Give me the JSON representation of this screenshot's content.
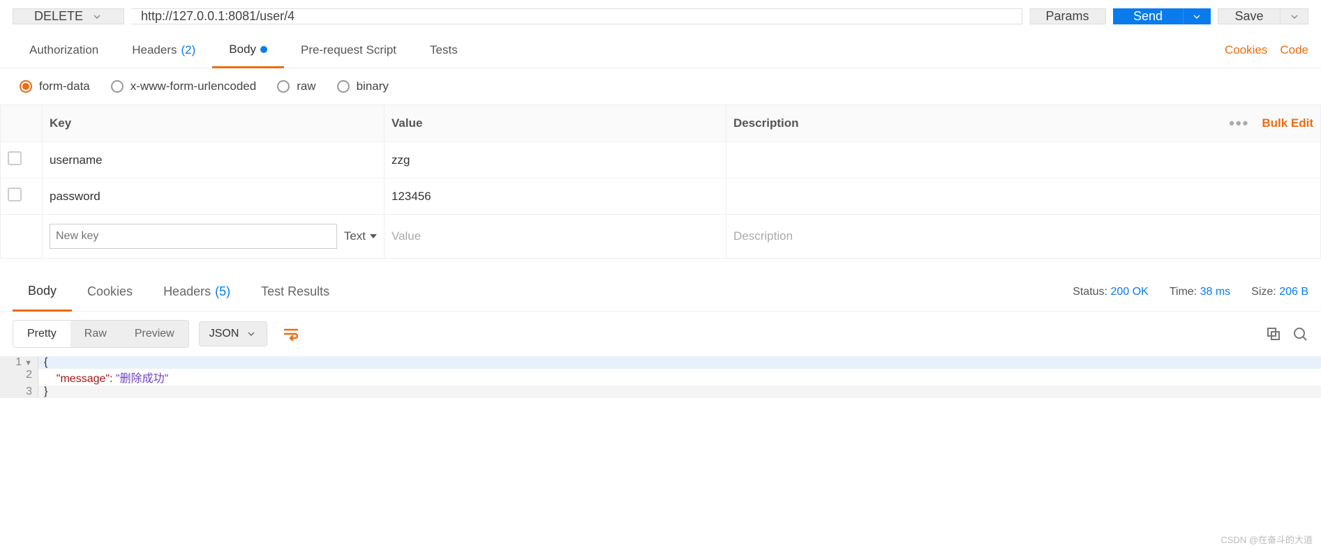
{
  "request": {
    "method": "DELETE",
    "url": "http://127.0.0.1:8081/user/4",
    "params_btn": "Params",
    "send_btn": "Send",
    "save_btn": "Save"
  },
  "req_tabs": {
    "authorization": "Authorization",
    "headers": "Headers",
    "headers_count": "(2)",
    "body": "Body",
    "prerequest": "Pre-request Script",
    "tests": "Tests",
    "cookies_link": "Cookies",
    "code_link": "Code"
  },
  "body_types": {
    "form_data": "form-data",
    "urlencoded": "x-www-form-urlencoded",
    "raw": "raw",
    "binary": "binary"
  },
  "kv_headers": {
    "key": "Key",
    "value": "Value",
    "description": "Description",
    "bulk_edit": "Bulk Edit"
  },
  "kv_rows": [
    {
      "key": "username",
      "value": "zzg"
    },
    {
      "key": "password",
      "value": "123456"
    }
  ],
  "kv_new": {
    "key_placeholder": "New key",
    "type": "Text",
    "value_placeholder": "Value",
    "desc_placeholder": "Description"
  },
  "resp_tabs": {
    "body": "Body",
    "cookies": "Cookies",
    "headers": "Headers",
    "headers_count": "(5)",
    "test_results": "Test Results"
  },
  "resp_meta": {
    "status_label": "Status:",
    "status_value": "200 OK",
    "time_label": "Time:",
    "time_value": "38 ms",
    "size_label": "Size:",
    "size_value": "206 B"
  },
  "resp_toolbar": {
    "pretty": "Pretty",
    "raw": "Raw",
    "preview": "Preview",
    "format": "JSON"
  },
  "response_body": {
    "line1_num": "1",
    "line1_txt": "{",
    "line2_num": "2",
    "line2_key": "\"message\"",
    "line2_sep": ": ",
    "line2_val": "\"删除成功\"",
    "line3_num": "3",
    "line3_txt": "}"
  },
  "watermark": "CSDN @在奋斗的大道"
}
